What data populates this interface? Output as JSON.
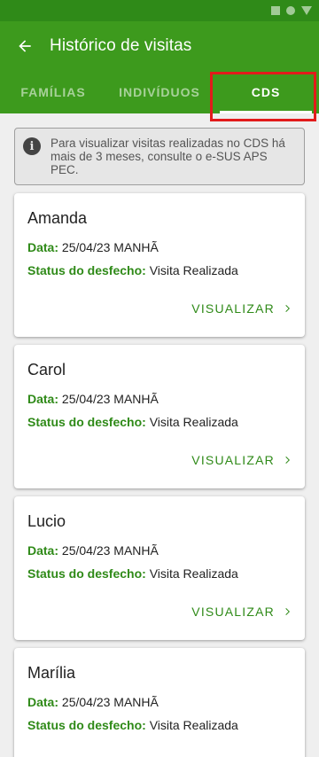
{
  "header": {
    "title": "Histórico de visitas"
  },
  "tabs": [
    {
      "label": "FAMÍLIAS",
      "active": false
    },
    {
      "label": "INDIVÍDUOS",
      "active": false
    },
    {
      "label": "CDS",
      "active": true
    }
  ],
  "info": {
    "text": "Para visualizar visitas realizadas no CDS há mais de 3 meses, consulte o e-SUS APS PEC."
  },
  "labels": {
    "date": "Data:",
    "status": "Status do desfecho:",
    "action": "VISUALIZAR"
  },
  "visits": [
    {
      "name": "Amanda",
      "date": "25/04/23 MANHÃ",
      "status": "Visita Realizada"
    },
    {
      "name": "Carol",
      "date": "25/04/23 MANHÃ",
      "status": "Visita Realizada"
    },
    {
      "name": "Lucio",
      "date": "25/04/23 MANHÃ",
      "status": "Visita Realizada"
    },
    {
      "name": "Marília",
      "date": "25/04/23 MANHÃ",
      "status": "Visita Realizada"
    }
  ],
  "colors": {
    "app_bar": "#3d9a1d",
    "status_bar": "#2f8a18",
    "accent_green": "#2f8a18",
    "highlight": "#e21b1b"
  },
  "icons": {
    "back": "arrow-left-icon",
    "info": "info-icon",
    "chevron": "chevron-right-icon"
  }
}
